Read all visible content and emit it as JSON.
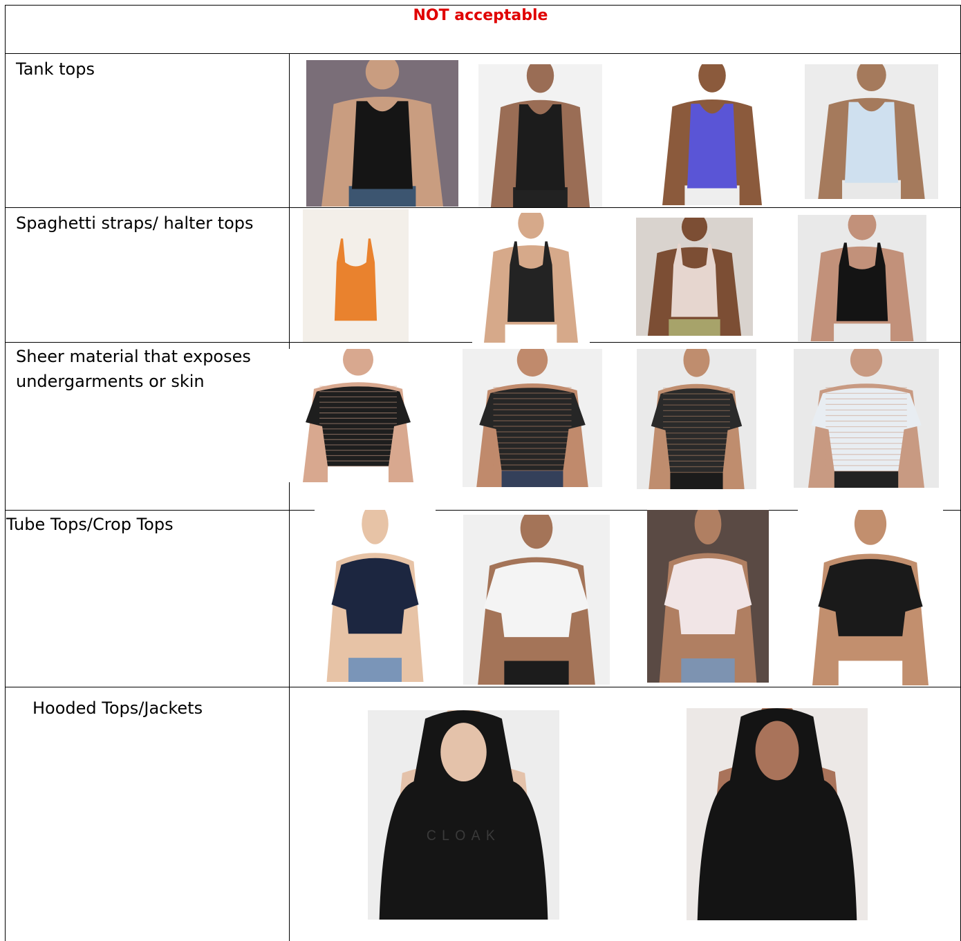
{
  "header": {
    "title": "NOT acceptable",
    "title_color": "#e00000"
  },
  "rows": [
    {
      "label": "Tank tops",
      "photos": [
        {
          "name": "black-tank-top-woman-photo",
          "bg": "#7a6e78",
          "skin": "#c99d80",
          "garment": "#151515",
          "bottom": "#3c5570"
        },
        {
          "name": "black-moon-print-tank-man-photo",
          "bg": "#f2f2f2",
          "skin": "#9a6d55",
          "garment": "#1c1c1c",
          "bottom": "#222222"
        },
        {
          "name": "blue-tank-top-woman-photo",
          "bg": "#ffffff",
          "skin": "#8b5a3c",
          "garment": "#5a55d6",
          "bottom": "#eeeeee"
        },
        {
          "name": "white-blue-gradient-tank-man-photo",
          "bg": "#ececec",
          "skin": "#a57a5c",
          "garment": "#cfe0ef",
          "bottom": "#e8e8e8"
        }
      ]
    },
    {
      "label": "Spaghetti straps/ halter tops",
      "photos": [
        {
          "name": "orange-camisole-photo",
          "bg": "#f3efe9",
          "skin": "#f3efe9",
          "garment": "#e9822e",
          "bottom": "#f3efe9"
        },
        {
          "name": "black-strappy-back-top-photo",
          "bg": "#ffffff",
          "skin": "#d6a98a",
          "garment": "#232323",
          "bottom": "#ffffff"
        },
        {
          "name": "geometric-halter-top-photo",
          "bg": "#d9d3ce",
          "skin": "#7c4e34",
          "garment": "#e6d6cf",
          "bottom": "#a7a36a"
        },
        {
          "name": "black-double-strap-tank-photo",
          "bg": "#e9e9e9",
          "skin": "#c2917a",
          "garment": "#141414",
          "bottom": "#e9e9e9"
        }
      ]
    },
    {
      "label": "Sheer material that exposes undergarments or skin",
      "photos": [
        {
          "name": "mesh-tee-man-photo",
          "bg": "#ffffff",
          "skin": "#d8a88f",
          "garment": "#1e1e1e",
          "bottom": "#ffffff"
        },
        {
          "name": "sheer-black-top-woman-photo",
          "bg": "#f0f0f0",
          "skin": "#c08a6c",
          "garment": "#262626",
          "bottom": "#34405a"
        },
        {
          "name": "fishnet-long-sleeve-man-photo",
          "bg": "#eaeaea",
          "skin": "#bf8d6e",
          "garment": "#2a2a2a",
          "bottom": "#1b1b1b"
        },
        {
          "name": "sheer-white-tulle-top-photo",
          "bg": "#e9e9e9",
          "skin": "#c89a82",
          "garment": "#e8edf2",
          "bottom": "#222222"
        }
      ]
    },
    {
      "label": "Tube Tops/Crop Tops",
      "photos": [
        {
          "name": "navy-crop-sweater-woman-photo",
          "bg": "#ffffff",
          "skin": "#e7c3a6",
          "garment": "#1c2640",
          "bottom": "#7a95b8"
        },
        {
          "name": "white-crop-tee-man-photo",
          "bg": "#f0f0f0",
          "skin": "#a47458",
          "garment": "#f4f4f4",
          "bottom": "#1c1c1c"
        },
        {
          "name": "floral-tube-top-photo",
          "bg": "#5a4a44",
          "skin": "#b07f62",
          "garment": "#f1e5e6",
          "bottom": "#7d93b1"
        },
        {
          "name": "black-crop-tee-man-photo",
          "bg": "#ffffff",
          "skin": "#c28f6e",
          "garment": "#1a1a1a",
          "bottom": "#ffffff"
        }
      ]
    },
    {
      "label": "Hooded Tops/Jackets",
      "photos": [
        {
          "name": "black-hoodie-man-photo",
          "bg": "#ededed",
          "skin": "#e4c2aa",
          "garment": "#151515",
          "bottom": "#151515",
          "print": "CLOAK"
        },
        {
          "name": "black-hooded-jacket-woman-photo",
          "bg": "#ece8e6",
          "skin": "#a9735a",
          "garment": "#141414",
          "bottom": "#141414"
        }
      ]
    }
  ]
}
